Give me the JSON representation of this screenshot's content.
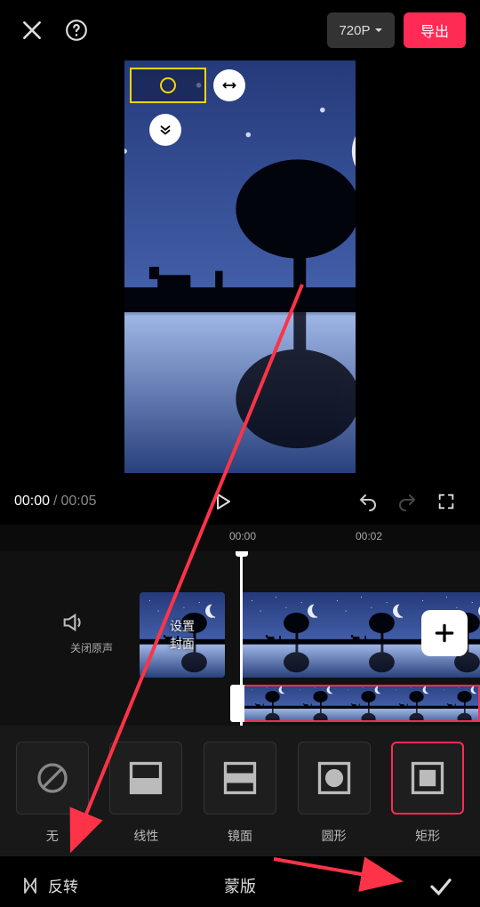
{
  "topbar": {
    "resolution": "720P",
    "export_label": "导出"
  },
  "transport": {
    "current": "00:00",
    "duration": "00:05"
  },
  "ruler": {
    "marks": [
      "00:00",
      "00:02"
    ]
  },
  "audio": {
    "mute_label": "关闭原声"
  },
  "cover": {
    "label_line1": "设置",
    "label_line2": "封面"
  },
  "mask": {
    "items": [
      {
        "key": "none",
        "label": "无"
      },
      {
        "key": "linear",
        "label": "线性"
      },
      {
        "key": "mirror",
        "label": "镜面"
      },
      {
        "key": "circle",
        "label": "圆形"
      },
      {
        "key": "rect",
        "label": "矩形"
      }
    ],
    "selected": "rect"
  },
  "bottombar": {
    "flip_label": "反转",
    "title": "蒙版"
  },
  "colors": {
    "accent": "#ff2b54",
    "highlight": "#ffd400"
  }
}
